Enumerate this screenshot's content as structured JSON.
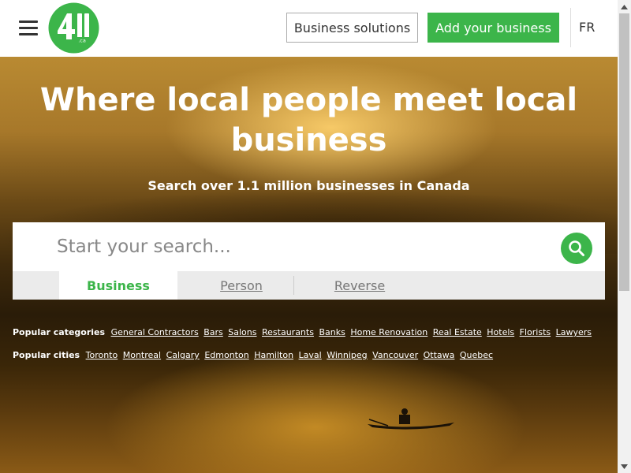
{
  "header": {
    "logo_text": "411.ca",
    "business_solutions_label": "Business solutions",
    "add_business_label": "Add your business",
    "lang_label": "FR"
  },
  "hero": {
    "title": "Where local people meet local business",
    "subtitle": "Search over 1.1 million businesses in Canada"
  },
  "search": {
    "placeholder": "Start your search...",
    "tabs": [
      {
        "label": "Business",
        "active": true
      },
      {
        "label": "Person",
        "active": false
      },
      {
        "label": "Reverse",
        "active": false
      }
    ]
  },
  "popular_categories": {
    "label": "Popular categories",
    "items": [
      "General Contractors",
      "Bars",
      "Salons",
      "Restaurants",
      "Banks",
      "Home Renovation",
      "Real Estate",
      "Hotels",
      "Florists",
      "Lawyers"
    ]
  },
  "popular_cities": {
    "label": "Popular cities",
    "items": [
      "Toronto",
      "Montreal",
      "Calgary",
      "Edmonton",
      "Hamilton",
      "Laval",
      "Winnipeg",
      "Vancouver",
      "Ottawa",
      "Quebec"
    ]
  },
  "colors": {
    "brand_green": "#3cb54a",
    "header_bg": "#ffffff"
  }
}
